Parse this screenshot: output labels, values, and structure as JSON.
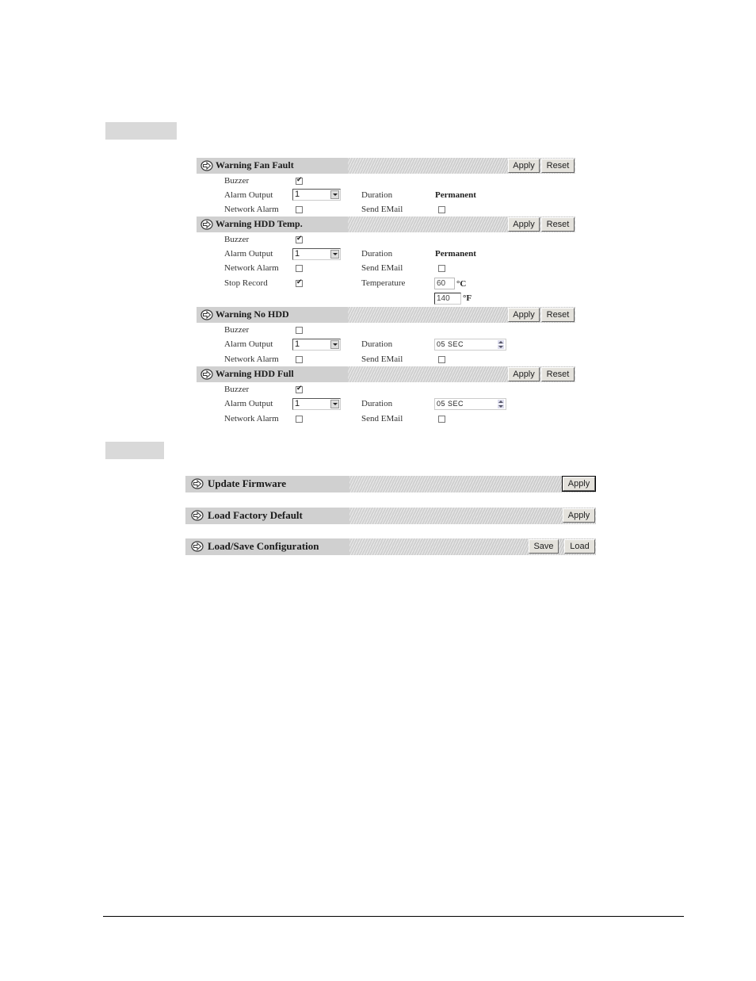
{
  "alarm_section": {
    "panels": [
      {
        "title": "Warning Fan Fault",
        "buttons": [
          "Apply",
          "Reset"
        ],
        "buzzer": {
          "label": "Buzzer",
          "checked": true
        },
        "alarm_output": {
          "label": "Alarm Output",
          "value": "1"
        },
        "duration": {
          "label": "Duration",
          "value": "Permanent"
        },
        "network_alarm": {
          "label": "Network Alarm",
          "checked": false
        },
        "send_email": {
          "label": "Send EMail",
          "checked": false
        }
      },
      {
        "title": "Warning HDD Temp.",
        "buttons": [
          "Apply",
          "Reset"
        ],
        "buzzer": {
          "label": "Buzzer",
          "checked": true
        },
        "alarm_output": {
          "label": "Alarm Output",
          "value": "1"
        },
        "duration": {
          "label": "Duration",
          "value": "Permanent"
        },
        "network_alarm": {
          "label": "Network Alarm",
          "checked": false
        },
        "send_email": {
          "label": "Send EMail",
          "checked": false
        },
        "stop_record": {
          "label": "Stop Record",
          "checked": true
        },
        "temperature": {
          "label": "Temperature",
          "celsius": "60",
          "celsius_unit": "°C",
          "fahrenheit": "140",
          "fahrenheit_unit": "°F"
        }
      },
      {
        "title": "Warning No HDD",
        "buttons": [
          "Apply",
          "Reset"
        ],
        "buzzer": {
          "label": "Buzzer",
          "checked": false
        },
        "alarm_output": {
          "label": "Alarm Output",
          "value": "1"
        },
        "duration": {
          "label": "Duration",
          "value": "05 SEC"
        },
        "network_alarm": {
          "label": "Network Alarm",
          "checked": false
        },
        "send_email": {
          "label": "Send EMail",
          "checked": false
        }
      },
      {
        "title": "Warning HDD Full",
        "buttons": [
          "Apply",
          "Reset"
        ],
        "buzzer": {
          "label": "Buzzer",
          "checked": true
        },
        "alarm_output": {
          "label": "Alarm Output",
          "value": "1"
        },
        "duration": {
          "label": "Duration",
          "value": "05 SEC"
        },
        "network_alarm": {
          "label": "Network Alarm",
          "checked": false
        },
        "send_email": {
          "label": "Send EMail",
          "checked": false
        }
      }
    ]
  },
  "system_section": {
    "panels": [
      {
        "title": "Update Firmware",
        "buttons": [
          "Apply"
        ]
      },
      {
        "title": "Load Factory Default",
        "buttons": [
          "Apply"
        ]
      },
      {
        "title": "Load/Save Configuration",
        "buttons": [
          "Save",
          "Load"
        ]
      }
    ]
  },
  "icons": {
    "panel_arrow": "arrow-right-circle-icon"
  }
}
